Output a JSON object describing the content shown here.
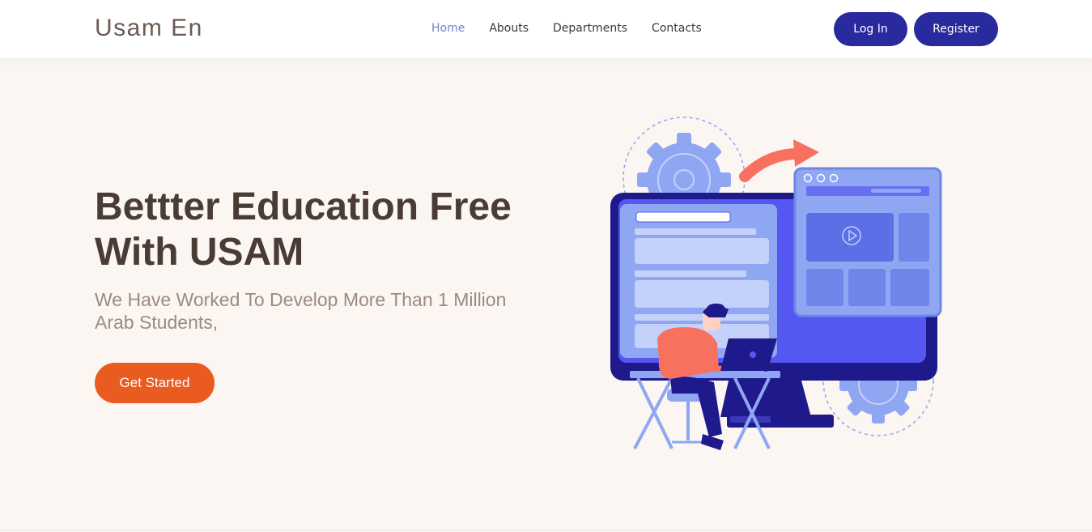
{
  "brand": {
    "name": "Usam En"
  },
  "nav": {
    "items": [
      {
        "label": "Home",
        "active": true
      },
      {
        "label": "Abouts",
        "active": false
      },
      {
        "label": "Departments",
        "active": false
      },
      {
        "label": "Contacts",
        "active": false
      }
    ]
  },
  "auth": {
    "login_label": "Log In",
    "register_label": "Register"
  },
  "hero": {
    "title": "Bettter Education Free With USAM",
    "subtitle": "We Have Worked To Develop More Than 1 Million Arab Students,",
    "cta_label": "Get Started"
  },
  "colors": {
    "accent": "#282a9e",
    "cta": "#ea5b20",
    "nav_active": "#7a7fcb",
    "background": "#fbf6f2",
    "heading": "#4b3b35"
  },
  "icons": {
    "illustration": "person-at-computer-illustration",
    "gear": "gear-icon",
    "arrow": "arrow-icon",
    "play": "play-icon"
  }
}
